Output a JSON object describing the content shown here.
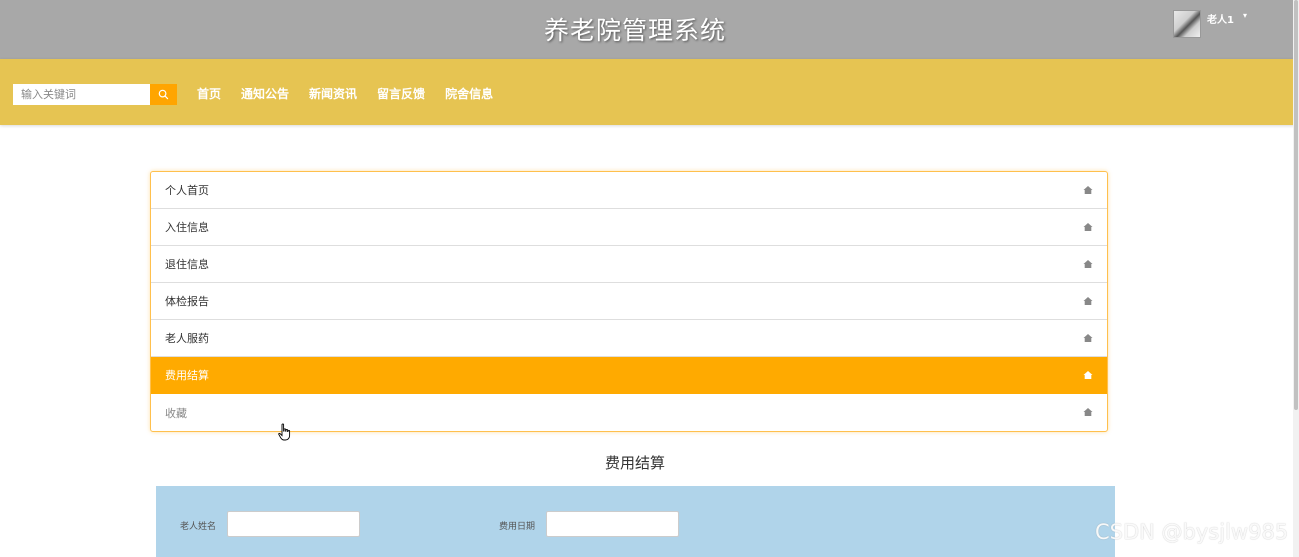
{
  "header": {
    "site_title": "养老院管理系统",
    "username": "老人1",
    "caret": "▾"
  },
  "nav": {
    "search_placeholder": "输入关键词",
    "links": [
      "首页",
      "通知公告",
      "新闻资讯",
      "留言反馈",
      "院舍信息"
    ]
  },
  "menu": {
    "items": [
      {
        "label": "个人首页",
        "state": "normal"
      },
      {
        "label": "入住信息",
        "state": "normal"
      },
      {
        "label": "退住信息",
        "state": "normal"
      },
      {
        "label": "体检报告",
        "state": "normal"
      },
      {
        "label": "老人服药",
        "state": "normal"
      },
      {
        "label": "费用结算",
        "state": "active"
      },
      {
        "label": "收藏",
        "state": "hover"
      }
    ],
    "item_icon": "home-icon"
  },
  "content": {
    "section_title": "费用结算",
    "form": {
      "name_label": "老人姓名",
      "name_value": "",
      "date_label": "费用日期",
      "date_value": ""
    }
  },
  "watermark": "CSDN @bysjlw985",
  "colors": {
    "topbar": "#a8a8a8",
    "navbar": "#e6c452",
    "accent": "#ffaa00",
    "form_panel": "#b0d4ea"
  }
}
